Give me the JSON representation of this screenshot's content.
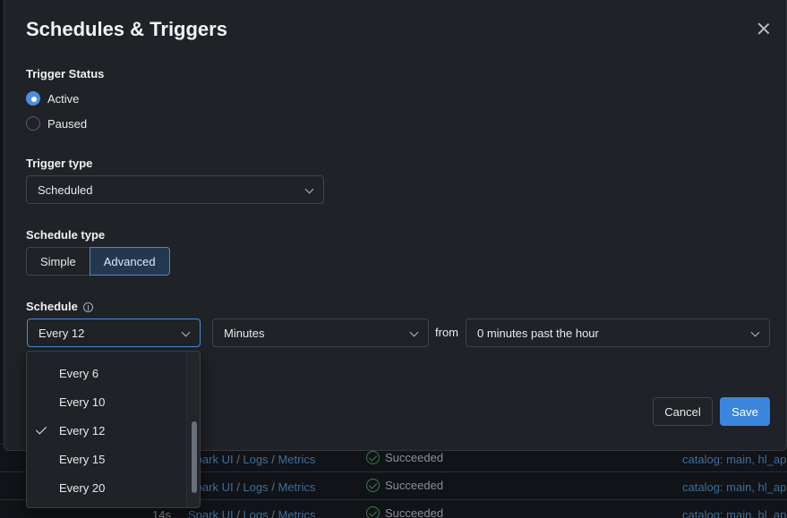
{
  "modal": {
    "title": "Schedules & Triggers",
    "close_icon": "close-icon"
  },
  "trigger_status": {
    "label": "Trigger Status",
    "options": [
      {
        "label": "Active",
        "selected": true
      },
      {
        "label": "Paused",
        "selected": false
      }
    ]
  },
  "trigger_type": {
    "label": "Trigger type",
    "value": "Scheduled"
  },
  "schedule_type": {
    "label": "Schedule type",
    "options": [
      {
        "label": "Simple",
        "selected": false
      },
      {
        "label": "Advanced",
        "selected": true
      }
    ]
  },
  "schedule": {
    "label": "Schedule",
    "interval_value": "Every 12",
    "unit_value": "Minutes",
    "from_label": "from",
    "offset_value": "0 minutes past the hour"
  },
  "interval_dropdown": {
    "items": [
      {
        "label": "Every 6",
        "checked": false
      },
      {
        "label": "Every 10",
        "checked": false
      },
      {
        "label": "Every 12",
        "checked": true
      },
      {
        "label": "Every 15",
        "checked": false
      },
      {
        "label": "Every 20",
        "checked": false
      }
    ]
  },
  "footer": {
    "cancel_label": "Cancel",
    "save_label": "Save"
  },
  "background_rows": [
    {
      "duration": "",
      "links": [
        "Spark UI",
        "Logs",
        "Metrics"
      ],
      "status": "Succeeded",
      "tags": "catalog: main, hl_ap"
    },
    {
      "duration": "",
      "links": [
        "Spark UI",
        "Logs",
        "Metrics"
      ],
      "status": "Succeeded",
      "tags": "catalog: main, hl_ap"
    },
    {
      "duration": "14s",
      "links": [
        "Spark UI",
        "Logs",
        "Metrics"
      ],
      "status": "Succeeded",
      "tags": "catalog: main, hl_ap"
    }
  ],
  "colors": {
    "accent": "#3a86de",
    "background": "#1f2226",
    "success": "#3f7c4a"
  }
}
